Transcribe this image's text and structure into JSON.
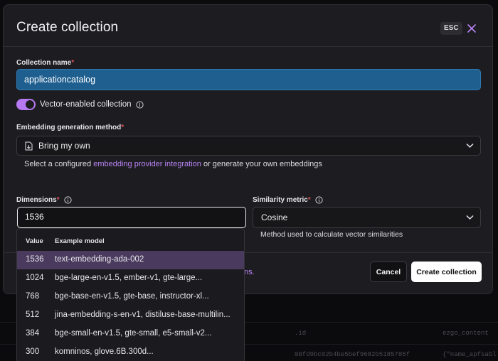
{
  "modal": {
    "title": "Create collection",
    "esc_label": "ESC"
  },
  "collection_name": {
    "label": "Collection name",
    "required_mark": "*",
    "value": "applicationcatalog"
  },
  "vector_toggle": {
    "label": "Vector-enabled collection",
    "enabled": true
  },
  "embedding_method": {
    "label": "Embedding generation method",
    "required_mark": "*",
    "value": "Bring my own",
    "helper_prefix": "Select a configured",
    "helper_link": "embedding provider integration",
    "helper_suffix": "or generate your own embeddings"
  },
  "dimensions": {
    "label": "Dimensions",
    "required_mark": "*",
    "value": "1536"
  },
  "similarity_metric": {
    "label": "Similarity metric",
    "required_mark": "*",
    "value": "Cosine",
    "helper": "Method used to calculate vector similarities"
  },
  "footer": {
    "partial_link": "ns.",
    "cancel_label": "Cancel",
    "create_label": "Create collection"
  },
  "dropdown": {
    "header_value": "Value",
    "header_model": "Example model",
    "options": [
      {
        "value": "1536",
        "model": "text-embedding-ada-002",
        "selected": true
      },
      {
        "value": "1024",
        "model": "bge-large-en-v1.5, ember-v1, gte-large..."
      },
      {
        "value": "768",
        "model": "bge-base-en-v1.5, gte-base, instructor-xl..."
      },
      {
        "value": "512",
        "model": "jina-embedding-s-en-v1, distiluse-base-multilin..."
      },
      {
        "value": "384",
        "model": "bge-small-en-v1.5, gte-small, e5-small-v2..."
      },
      {
        "value": "300",
        "model": "komninos, glove.6B.300d..."
      }
    ]
  },
  "colors": {
    "accent": "#b779f2",
    "selected_row": "#4a3a5e",
    "name_input_bg": "#1f5f8f",
    "required": "#e0525c"
  },
  "background_table": {
    "cells": [
      ".id",
      "ezgo_content",
      "00fd9bc02b4be5bef9682b5185785f",
      "{\"name_apfsabl"
    ]
  }
}
